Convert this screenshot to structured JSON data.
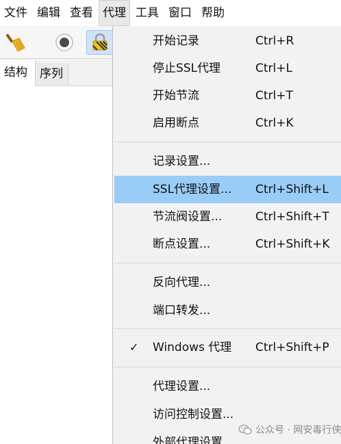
{
  "menubar": {
    "items": [
      "文件",
      "编辑",
      "查看",
      "代理",
      "工具",
      "窗口",
      "帮助"
    ],
    "active_index": 3
  },
  "toolbar": {
    "buttons": [
      {
        "icon": "broom-icon"
      },
      {
        "icon": "record-icon"
      },
      {
        "icon": "lock-icon"
      }
    ]
  },
  "left_panel": {
    "tabs": [
      "结构",
      "序列"
    ]
  },
  "dropdown": {
    "items": [
      {
        "label": "开始记录",
        "shortcut": "Ctrl+R",
        "checked": false,
        "highlighted": false
      },
      {
        "label": "停止SSL代理",
        "shortcut": "Ctrl+L",
        "checked": false,
        "highlighted": false
      },
      {
        "label": "开始节流",
        "shortcut": "Ctrl+T",
        "checked": false,
        "highlighted": false
      },
      {
        "label": "启用断点",
        "shortcut": "Ctrl+K",
        "checked": false,
        "highlighted": false
      },
      {
        "label": "记录设置...",
        "shortcut": "",
        "checked": false,
        "highlighted": false
      },
      {
        "label": "SSL代理设置...",
        "shortcut": "Ctrl+Shift+L",
        "checked": false,
        "highlighted": true
      },
      {
        "label": "节流阀设置...",
        "shortcut": "Ctrl+Shift+T",
        "checked": false,
        "highlighted": false
      },
      {
        "label": "断点设置...",
        "shortcut": "Ctrl+Shift+K",
        "checked": false,
        "highlighted": false
      },
      {
        "label": "反向代理...",
        "shortcut": "",
        "checked": false,
        "highlighted": false
      },
      {
        "label": "端口转发...",
        "shortcut": "",
        "checked": false,
        "highlighted": false
      },
      {
        "label": "Windows 代理",
        "shortcut": "Ctrl+Shift+P",
        "checked": true,
        "highlighted": false
      },
      {
        "label": "代理设置...",
        "shortcut": "",
        "checked": false,
        "highlighted": false
      },
      {
        "label": "访问控制设置...",
        "shortcut": "",
        "checked": false,
        "highlighted": false
      },
      {
        "label": "外部代理设置...",
        "shortcut": "",
        "checked": false,
        "highlighted": false
      }
    ],
    "check_glyph": "✓",
    "highlight_color": "#99ccf7"
  },
  "watermark": {
    "text": "公众号 · 网安毒行侠"
  }
}
